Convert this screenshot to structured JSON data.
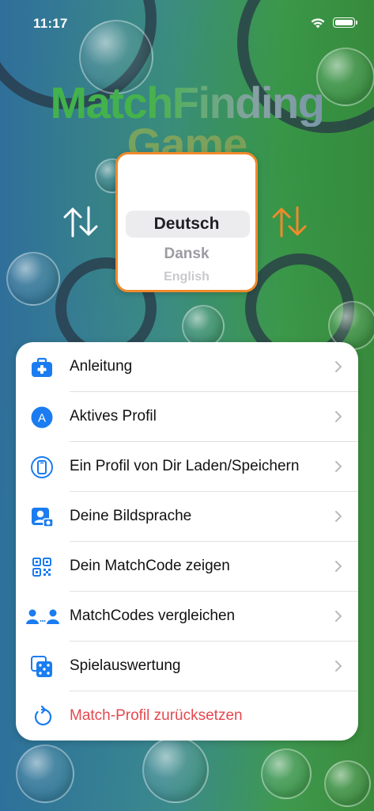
{
  "status_bar": {
    "time": "11:17"
  },
  "app": {
    "title_line1": "MatchFinding",
    "title_line2": "Game"
  },
  "language_picker": {
    "selected": "Deutsch",
    "next": "Dansk",
    "far": "English"
  },
  "colors": {
    "accent_blue": "#1a7cf0",
    "destructive_red": "#e5484d",
    "picker_border_orange": "#f08a2c"
  },
  "menu": {
    "items": [
      {
        "label": "Anleitung",
        "icon": "medical-case-icon"
      },
      {
        "label": "Aktives Profil",
        "icon": "profile-a-circle-icon"
      },
      {
        "label": "Ein Profil von Dir Laden/Speichern",
        "icon": "phone-circle-icon"
      },
      {
        "label": "Deine Bildsprache",
        "icon": "person-camera-icon"
      },
      {
        "label": "Dein MatchCode zeigen",
        "icon": "qr-code-icon"
      },
      {
        "label": "MatchCodes vergleichen",
        "icon": "two-people-icon"
      },
      {
        "label": "Spielauswertung",
        "icon": "dice-icon"
      },
      {
        "label": "Match-Profil zurücksetzen",
        "icon": "reset-arrow-icon"
      }
    ]
  }
}
